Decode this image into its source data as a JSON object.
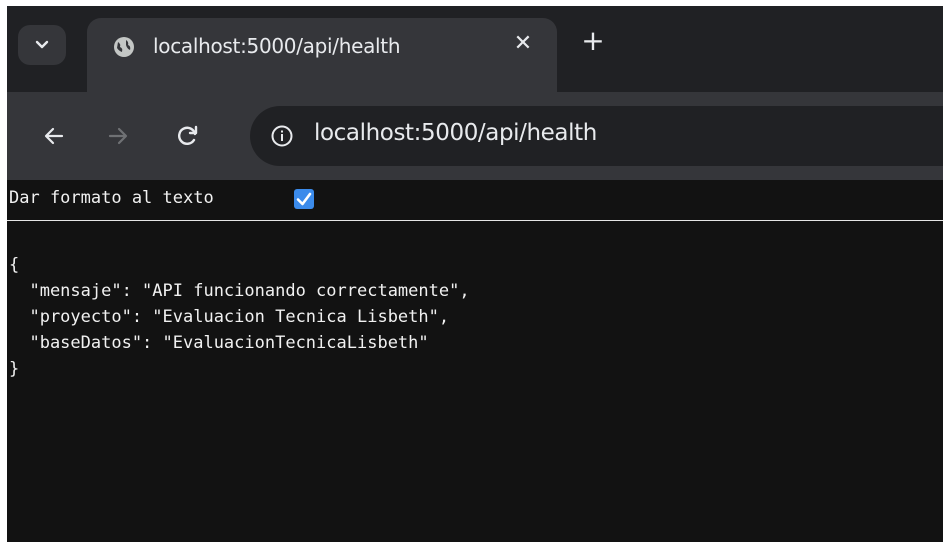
{
  "browser": {
    "tab": {
      "title": "localhost:5000/api/health",
      "favicon": "globe-icon",
      "close_icon": "close-icon"
    },
    "new_tab_icon": "plus-icon",
    "tab_search_icon": "chevron-down-icon",
    "toolbar": {
      "back_icon": "back-arrow-icon",
      "forward_icon": "forward-arrow-icon",
      "reload_icon": "reload-icon",
      "site_info_icon": "info-icon",
      "url": "localhost:5000/api/health"
    }
  },
  "page": {
    "pretty_print_label": "Dar formato al texto",
    "pretty_print_checked": true,
    "json_lines": {
      "open": "{",
      "line1": "  \"mensaje\": \"API funcionando correctamente\",",
      "line2": "  \"proyecto\": \"Evaluacion Tecnica Lisbeth\",",
      "line3": "  \"baseDatos\": \"EvaluacionTecnicaLisbeth\"",
      "close": "}"
    }
  },
  "colors": {
    "chrome_dark": "#202124",
    "tab_active": "#35363a",
    "content_bg": "#121212",
    "checkbox": "#3b8beb"
  }
}
